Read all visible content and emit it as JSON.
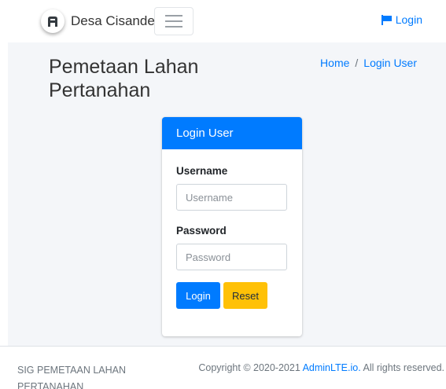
{
  "navbar": {
    "brand_text": "Desa Cisande",
    "brand_icon": "brand-logo-icon",
    "menu_icon": "hamburger-icon",
    "login_label": "Login",
    "login_icon": "flag-icon"
  },
  "content_header": {
    "title": "Pemetaan Lahan Pertanahan",
    "breadcrumb": {
      "home": "Home",
      "separator": "/",
      "current": "Login User"
    }
  },
  "login_card": {
    "header": "Login User",
    "username_label": "Username",
    "username_placeholder": "Username",
    "username_value": "",
    "password_label": "Password",
    "password_placeholder": "Password",
    "password_value": "",
    "login_button": "Login",
    "reset_button": "Reset"
  },
  "footer": {
    "left_text": "SIG PEMETAAN LAHAN PERTANAHAN",
    "copyright_prefix": "Copyright © 2020-2021",
    "copyright_link": "AdminLTE.io.",
    "copyright_suffix": "All rights reserved."
  },
  "colors": {
    "primary": "#007bff",
    "warning": "#ffc107",
    "content_bg": "#f4f6f9"
  }
}
